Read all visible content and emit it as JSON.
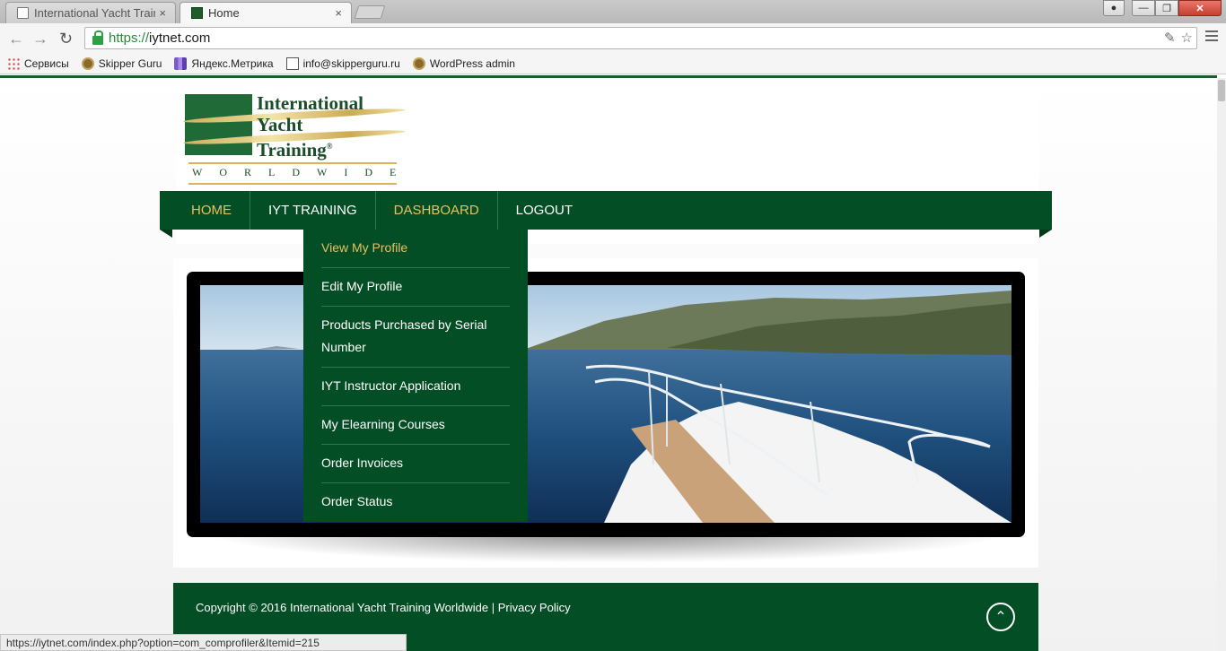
{
  "browser": {
    "tabs": [
      {
        "title": "International Yacht Trainin",
        "active": false
      },
      {
        "title": "Home",
        "active": true
      }
    ],
    "close_glyph": "×",
    "url_scheme": "https://",
    "url_host": "iytnet.com",
    "bookmarks": [
      {
        "label": "Сервисы",
        "icon": "apps-grid-icon"
      },
      {
        "label": "Skipper Guru",
        "icon": "ship-wheel-icon"
      },
      {
        "label": "Яндекс.Метрика",
        "icon": "metrika-icon"
      },
      {
        "label": "info@skipperguru.ru",
        "icon": "mail-icon"
      },
      {
        "label": "WordPress admin",
        "icon": "ship-wheel-icon"
      }
    ],
    "status_url": "https://iytnet.com/index.php?option=com_comprofiler&Itemid=215"
  },
  "logo": {
    "line1": "International",
    "line2": "Yacht",
    "line3": "Training",
    "registered": "®",
    "tagline": "WORLDWIDE"
  },
  "nav": {
    "items": [
      {
        "label": "HOME",
        "color": "#e8c15c"
      },
      {
        "label": "IYT TRAINING",
        "color": "#ffffff"
      },
      {
        "label": "DASHBOARD",
        "color": "#e8c15c"
      },
      {
        "label": "LOGOUT",
        "color": "#ffffff"
      }
    ]
  },
  "dashboard_menu": {
    "items": [
      "View My Profile",
      "Edit My Profile",
      "Products Purchased by Serial Number",
      "IYT Instructor Application",
      "My Elearning Courses",
      "Order Invoices",
      "Order Status"
    ],
    "highlight_color": "#e8c15c"
  },
  "footer": {
    "copyright": "Copyright © 2016 International Yacht Training Worldwide | Privacy Policy"
  },
  "colors": {
    "brand_green": "#044e25",
    "gold": "#e8c15c"
  }
}
